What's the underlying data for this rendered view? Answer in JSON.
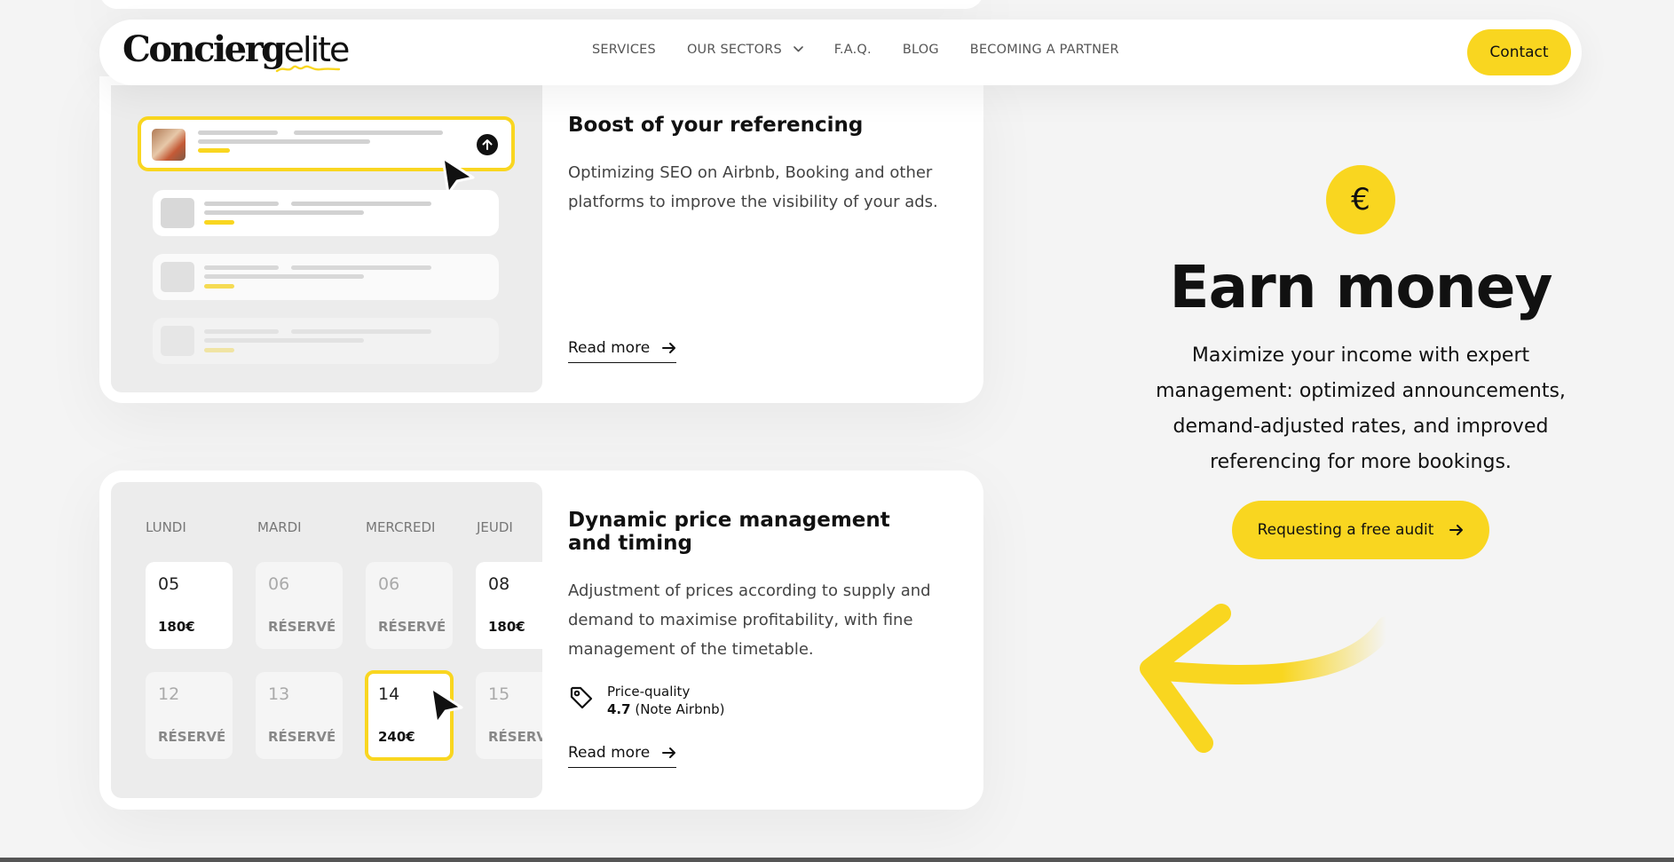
{
  "nav": {
    "logo_part1": "Concierg",
    "logo_part2": "elite",
    "menu": [
      "SERVICES",
      "OUR SECTORS",
      "F.A.Q.",
      "BLOG",
      "BECOMING A PARTNER"
    ],
    "contact": "Contact"
  },
  "cards": [
    {
      "title": "Boost of your referencing",
      "description": "Optimizing SEO on Airbnb, Booking and other platforms to improve the visibility of your ads.",
      "read_more": "Read more"
    },
    {
      "title": "Dynamic price management and timing",
      "description": "Adjustment of prices according to supply and demand to maximise profitability, with fine management of the timetable.",
      "badge_label": "Price-quality",
      "badge_rating": "4.7",
      "badge_note": "(Note Airbnb)",
      "read_more": "Read more"
    }
  ],
  "calendar": {
    "days": [
      "LUNDI",
      "MARDI",
      "MERCREDI",
      "JEUDI"
    ],
    "row1": [
      {
        "num": "05",
        "val": "180€"
      },
      {
        "num": "06",
        "val": "RÉSERVÉ"
      },
      {
        "num": "06",
        "val": "RÉSERVÉ"
      },
      {
        "num": "08",
        "val": "180€"
      }
    ],
    "row2": [
      {
        "num": "12",
        "val": "RÉSERVÉ"
      },
      {
        "num": "13",
        "val": "RÉSERVÉ"
      },
      {
        "num": "14",
        "val": "240€"
      },
      {
        "num": "15",
        "val": "RÉSERVÉ"
      }
    ]
  },
  "promo": {
    "currency_symbol": "€",
    "title": "Earn money",
    "description": "Maximize your income with expert management: optimized announcements, demand-adjusted rates, and improved referencing for more bookings.",
    "cta": "Requesting a free audit"
  },
  "colors": {
    "accent": "#f9d620",
    "background": "#f4f4f4",
    "card": "#ffffff",
    "text": "#111111"
  }
}
